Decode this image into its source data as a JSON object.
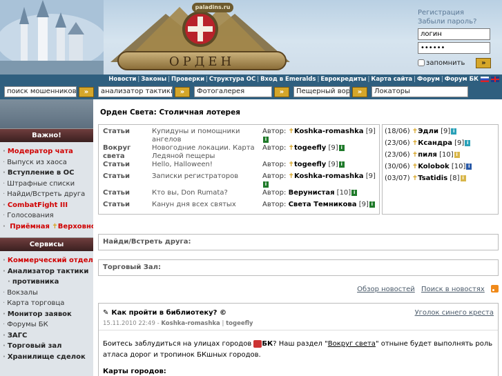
{
  "header": {
    "site_badge": "paladins.ru",
    "logo_text": "Орден Паладинов",
    "login": {
      "register_link": "Регистрация",
      "forgot_link": "Забыли пароль?",
      "username_value": "логин",
      "password_value": "••••••",
      "remember_label": "запомнить",
      "go_label": "»"
    }
  },
  "topnav": {
    "items": [
      "Новости",
      "Законы",
      "Проверки",
      "Структура ОС",
      "Вход в Emeralds",
      "Еврокредиты",
      "Карта сайта",
      "Форум",
      "Форум БК"
    ]
  },
  "toolsbar": {
    "items": [
      {
        "value": "поиск мошенников",
        "go": "»"
      },
      {
        "value": "анализатор тактики",
        "go": "»"
      },
      {
        "value": "Фотогалерея",
        "go": "»"
      },
      {
        "value": "Пещерный вор",
        "go": "»"
      },
      {
        "value": "Локаторы",
        "go": ""
      }
    ]
  },
  "sidebar": {
    "important": {
      "heading": "Важно!",
      "items": [
        {
          "label": "Модератор чата",
          "style": "red"
        },
        {
          "label": "Выпуск из хаоса",
          "style": "normal"
        },
        {
          "label": "Вступление в ОС",
          "style": "bold"
        },
        {
          "label": "Штрафные списки",
          "style": "normal"
        },
        {
          "label": "Найди/Встреть друга",
          "style": "normal"
        },
        {
          "label": "CombatFight III",
          "style": "red"
        },
        {
          "label": "Голосования",
          "style": "normal"
        },
        {
          "label": "Приёмная",
          "label2": "Верховного",
          "style": "red"
        }
      ]
    },
    "services": {
      "heading": "Сервисы",
      "items": [
        {
          "label": "Коммерческий отдел",
          "style": "red"
        },
        {
          "label": "Анализатор тактики",
          "style": "bold"
        },
        {
          "label": "противника",
          "style": "bold-cont"
        },
        {
          "label": "Вокзалы",
          "style": "normal"
        },
        {
          "label": "Карта торговца",
          "style": "normal"
        },
        {
          "label": "Монитор заявок",
          "style": "bold"
        },
        {
          "label": "Форумы БК",
          "style": "normal"
        },
        {
          "label": "ЗАГС",
          "style": "bold"
        },
        {
          "label": "Торговый зал",
          "style": "bold"
        },
        {
          "label": "Хранилище сделок",
          "style": "bold"
        }
      ]
    }
  },
  "main": {
    "title": "Орден Света: Столичная лотерея",
    "author_label": "Автор:",
    "articles": [
      {
        "section": "Статьи",
        "title": "Купидуны и помощники ангелов",
        "author": "Koshka-romashka",
        "level": "[9]",
        "cross": true
      },
      {
        "section": "Вокруг света",
        "title": "Новогодние локации. Карта Ледяной пещеры",
        "author": "togeefly",
        "level": "[9]",
        "cross": true
      },
      {
        "section": "Статьи",
        "title": "Hello, Halloween!",
        "author": "togeefly",
        "level": "[9]",
        "cross": true
      },
      {
        "section": "Статьи",
        "title": "Записки регистраторов",
        "author": "Koshka-romashka",
        "level": "[9]",
        "cross": true
      },
      {
        "section": "Статьи",
        "title": "Кто вы, Don Rumata?",
        "author": "Верунистая",
        "level": "[10]",
        "cross": false
      },
      {
        "section": "Статьи",
        "title": "Канун дня всех святых",
        "author": "Света Темникова",
        "level": "[9]",
        "cross": false
      }
    ],
    "birthdays": [
      {
        "date": "(18/06)",
        "name": "Эдли",
        "level": "[9]",
        "icon": "teal"
      },
      {
        "date": "(23/06)",
        "name": "Ксандра",
        "level": "[9]",
        "icon": "teal"
      },
      {
        "date": "(23/06)",
        "name": "пиля",
        "level": "[10]",
        "icon": "gold"
      },
      {
        "date": "(30/06)",
        "name": "Kolobok",
        "level": "[10]",
        "icon": "blue"
      },
      {
        "date": "(03/07)",
        "name": "Tsatidis",
        "level": "[8]",
        "icon": "gold"
      }
    ],
    "find_friend": "Найди/Встреть друга:",
    "trade_hall": "Торговый Зал:",
    "links": {
      "overview": "Обзор новостей",
      "search": "Поиск в новостях"
    },
    "news": {
      "title": "Как пройти в библиотеку? ©",
      "corner_link": "Уголок синего креста",
      "meta_date": "15.11.2010 22:49",
      "meta_author": "Koshka-romashka",
      "meta_tag": "togeefly",
      "body_1": "Боитесь заблудиться на улицах городов",
      "body_bk": "БК",
      "body_2": "? Наш раздел \"",
      "body_link": "Вокруг света",
      "body_3": "\" отныне будет выполнять роль атласа дорог и тропинок БКшных городов.",
      "cards": "Карты городов:"
    }
  },
  "colors": {
    "nav_bg": "#2f5f7f",
    "sidebar_head": "#4a2a2a",
    "accent_red": "#d00000",
    "button_gold": "#d5a62a"
  }
}
